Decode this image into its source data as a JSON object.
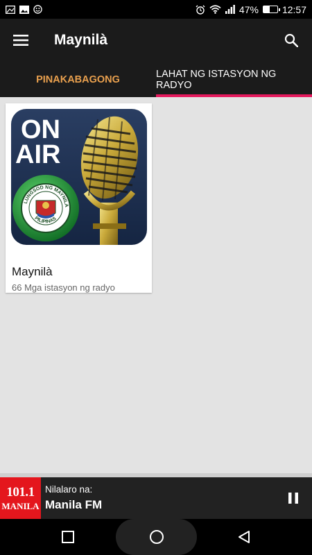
{
  "status_bar": {
    "battery_percent": "47%",
    "time": "12:57",
    "battery_level": 0.47,
    "icons": [
      "gallery-icon",
      "image-icon",
      "smiley-icon",
      "alarm-icon",
      "wifi-icon",
      "signal-icon",
      "battery-icon"
    ]
  },
  "app_bar": {
    "title": "Maynilà",
    "menu_icon": "hamburger-menu-icon",
    "search_icon": "search-icon"
  },
  "tabs": [
    {
      "label": "PINAKABAGONG",
      "active": false
    },
    {
      "label": "LAHAT NG ISTASYON NG RADYO",
      "active": true
    }
  ],
  "cards": [
    {
      "title": "Maynilà",
      "subtitle": "66 Mga istasyon ng radyo",
      "image": {
        "on_air_line1": "ON",
        "on_air_line2": "AIR",
        "seal_top_text": "LUNGSOD NG MAYNILA",
        "seal_bottom_text": "PILIPINAS"
      }
    }
  ],
  "player": {
    "logo_number": "101.1",
    "logo_city": "MANILA",
    "now_playing_label": "Nilalaro na:",
    "station_name": "Manila FM",
    "control_icon": "pause-icon"
  },
  "nav_bar": {
    "icons": [
      "recent-apps-icon",
      "home-icon",
      "back-icon"
    ]
  },
  "colors": {
    "app_bar_bg": "#1b1b1b",
    "active_tab_text": "#ffffff",
    "inactive_tab_text": "#e9a04e",
    "tab_indicator": "#e5195d",
    "content_bg": "#e3e3e3",
    "player_bg": "#222222",
    "logo_bg": "#e4161d"
  }
}
